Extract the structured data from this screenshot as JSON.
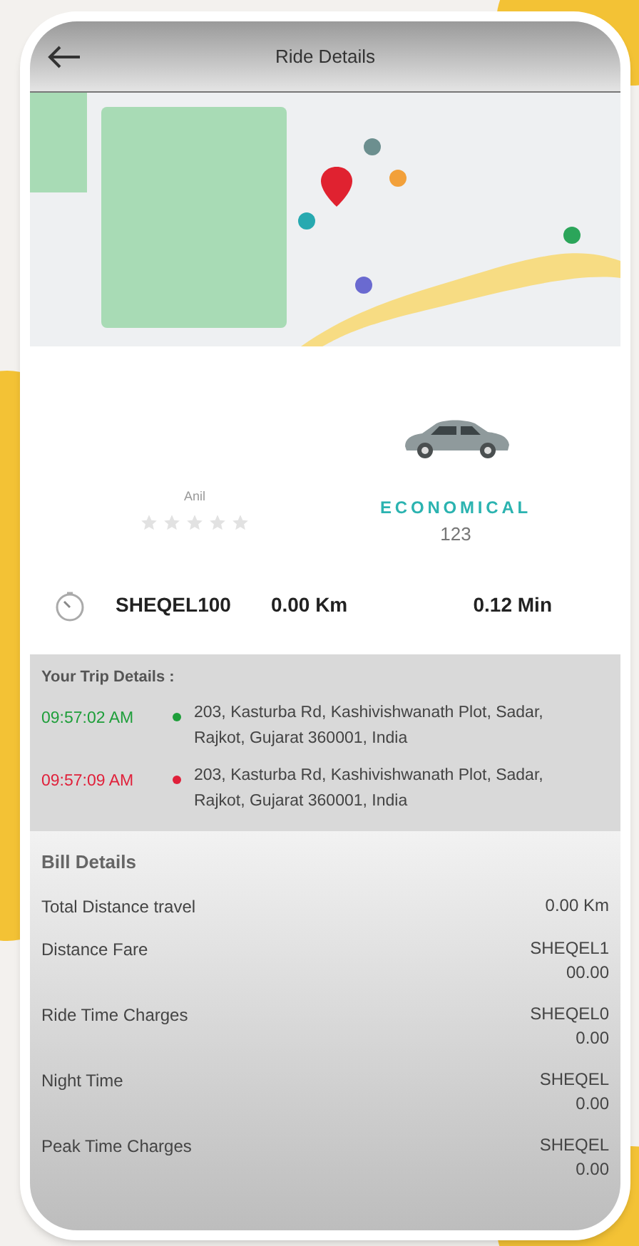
{
  "header": {
    "title": "Ride Details"
  },
  "driver": {
    "name": "Anil",
    "stars": 0
  },
  "vehicle": {
    "category": "ECONOMICAL",
    "number": "123"
  },
  "summary": {
    "fare": "SHEQEL100",
    "distance": "0.00 Km",
    "duration": "0.12 Min"
  },
  "trip": {
    "title": "Your Trip Details :",
    "stops": [
      {
        "time": "09:57:02 AM",
        "color": "#1e9e3a",
        "address": "203, Kasturba Rd, Kashivishwanath Plot, Sadar, Rajkot, Gujarat 360001, India"
      },
      {
        "time": "09:57:09 AM",
        "color": "#e0203a",
        "address": "203, Kasturba Rd, Kashivishwanath Plot, Sadar, Rajkot, Gujarat 360001, India"
      }
    ]
  },
  "bill": {
    "title": "Bill Details",
    "rows": [
      {
        "label": "Total Distance travel",
        "value": "0.00 Km"
      },
      {
        "label": "Distance Fare",
        "value": "SHEQEL100.00"
      },
      {
        "label": "Ride Time Charges",
        "value": "SHEQEL00.00"
      },
      {
        "label": "Night Time",
        "value": "SHEQEL0.00"
      },
      {
        "label": "Peak Time Charges",
        "value": "SHEQEL0.00"
      }
    ]
  }
}
